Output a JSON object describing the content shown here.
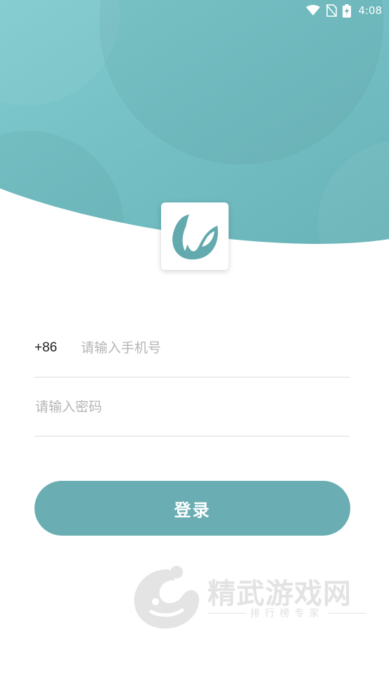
{
  "status_bar": {
    "time": "4:08",
    "icons": [
      "wifi-icon",
      "no-sim-icon",
      "battery-charging-icon"
    ]
  },
  "colors": {
    "header_teal": "#7ac3c7",
    "button_teal": "#6aadb2",
    "logo_teal": "#62aaae"
  },
  "app_logo": {
    "icon": "leaf-logo-icon"
  },
  "login_form": {
    "country_code": "+86",
    "phone_placeholder": "请输入手机号",
    "password_placeholder": "请输入密码",
    "login_label": "登录"
  },
  "watermark": {
    "title": "精武游戏网",
    "subtitle": "排行榜专家"
  }
}
